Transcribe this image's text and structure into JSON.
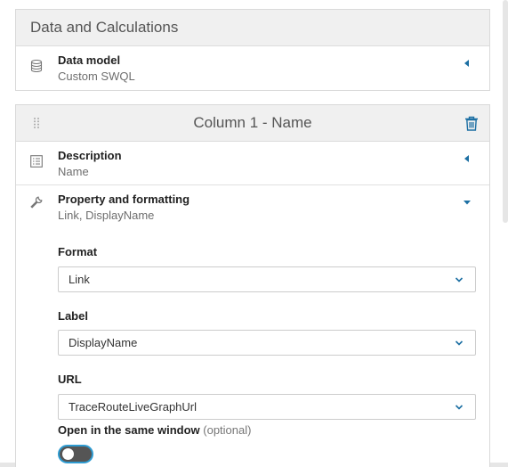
{
  "data_section": {
    "header": "Data and Calculations",
    "data_model": {
      "title": "Data model",
      "value": "Custom SWQL",
      "icon": "database-icon"
    }
  },
  "column": {
    "header": "Column 1 - Name",
    "description": {
      "title": "Description",
      "value": "Name",
      "icon": "list-icon"
    },
    "property": {
      "title": "Property and formatting",
      "value": "Link, DisplayName",
      "icon": "wrench-icon",
      "format": {
        "label": "Format",
        "selected": "Link"
      },
      "label_field": {
        "label": "Label",
        "selected": "DisplayName"
      },
      "url": {
        "label": "URL",
        "selected": "TraceRouteLiveGraphUrl"
      },
      "same_window": {
        "label": "Open in the same window",
        "optional": "(optional)",
        "enabled": false
      }
    }
  },
  "colors": {
    "accent": "#1c6fa3",
    "toggle_border": "#2e9bd1",
    "header_bg": "#f0f0f0"
  }
}
